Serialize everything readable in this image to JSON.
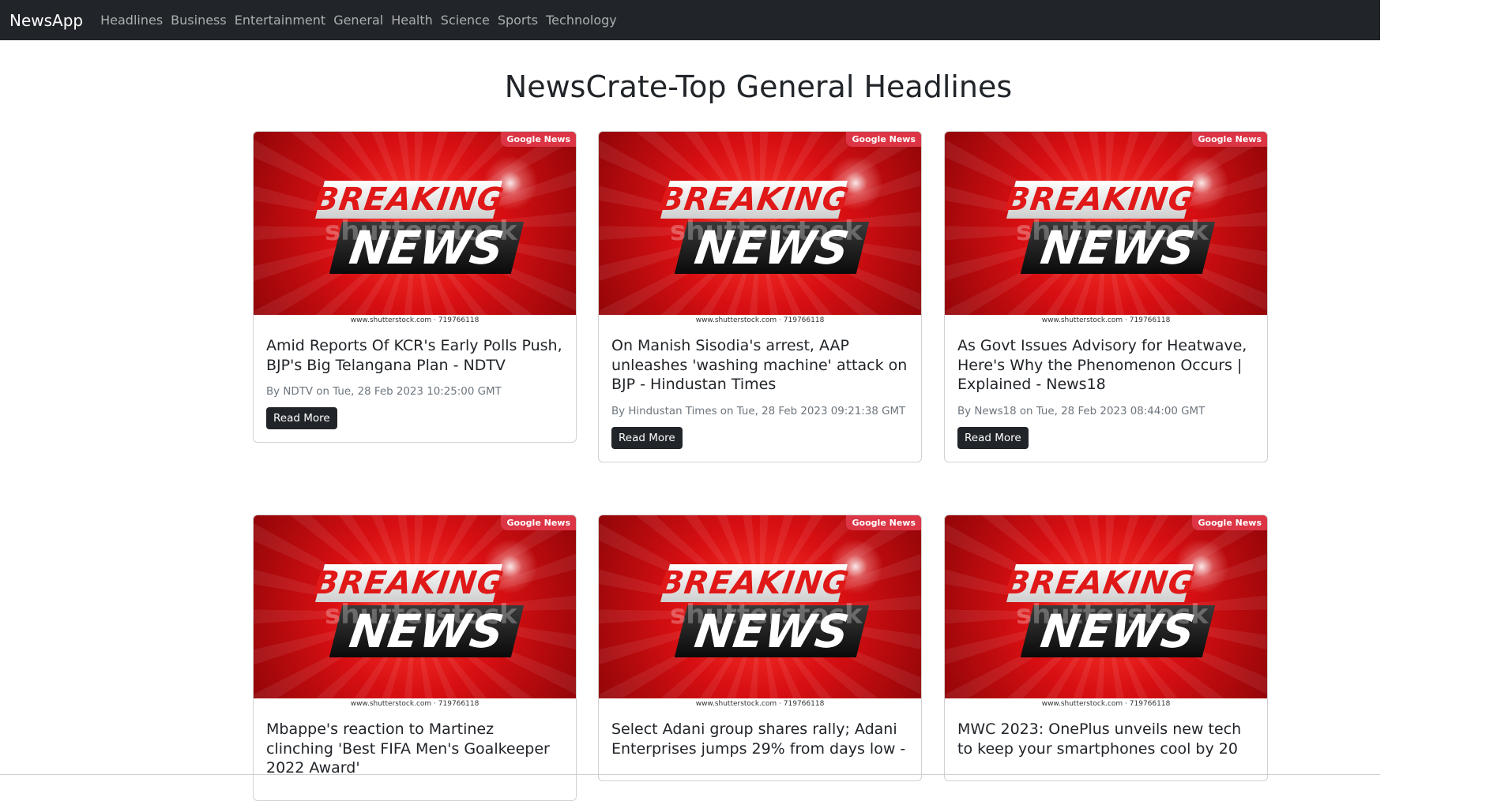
{
  "navbar": {
    "brand": "NewsApp",
    "links": [
      "Headlines",
      "Business",
      "Entertainment",
      "General",
      "Health",
      "Science",
      "Sports",
      "Technology"
    ]
  },
  "page": {
    "heading": "NewsCrate-Top General Headlines"
  },
  "image_labels": {
    "breaking": "BREAKING",
    "news": "NEWS",
    "watermark": "shutterstock",
    "credit": "www.shutterstock.com · 719766118"
  },
  "colors": {
    "navbar": "#212529",
    "badge": "#dc3545",
    "button": "#212529"
  },
  "articles": [
    {
      "source_badge": "Google News",
      "title": "Amid Reports Of KCR's Early Polls Push, BJP's Big Telangana Plan - NDTV",
      "meta": "By NDTV on Tue, 28 Feb 2023 10:25:00 GMT",
      "button": "Read More"
    },
    {
      "source_badge": "Google News",
      "title": "On Manish Sisodia's arrest, AAP unleashes 'washing machine' attack on BJP - Hindustan Times",
      "meta": "By Hindustan Times on Tue, 28 Feb 2023 09:21:38 GMT",
      "button": "Read More"
    },
    {
      "source_badge": "Google News",
      "title": "As Govt Issues Advisory for Heatwave, Here's Why the Phenomenon Occurs | Explained - News18",
      "meta": "By News18 on Tue, 28 Feb 2023 08:44:00 GMT",
      "button": "Read More"
    },
    {
      "source_badge": "Google News",
      "title": "Mbappe's reaction to Martinez clinching 'Best FIFA Men's Goalkeeper 2022 Award'"
    },
    {
      "source_badge": "Google News",
      "title": "Select Adani group shares rally; Adani Enterprises jumps 29% from days low -"
    },
    {
      "source_badge": "Google News",
      "title": "MWC 2023: OnePlus unveils new tech to keep your smartphones cool by 20"
    }
  ]
}
